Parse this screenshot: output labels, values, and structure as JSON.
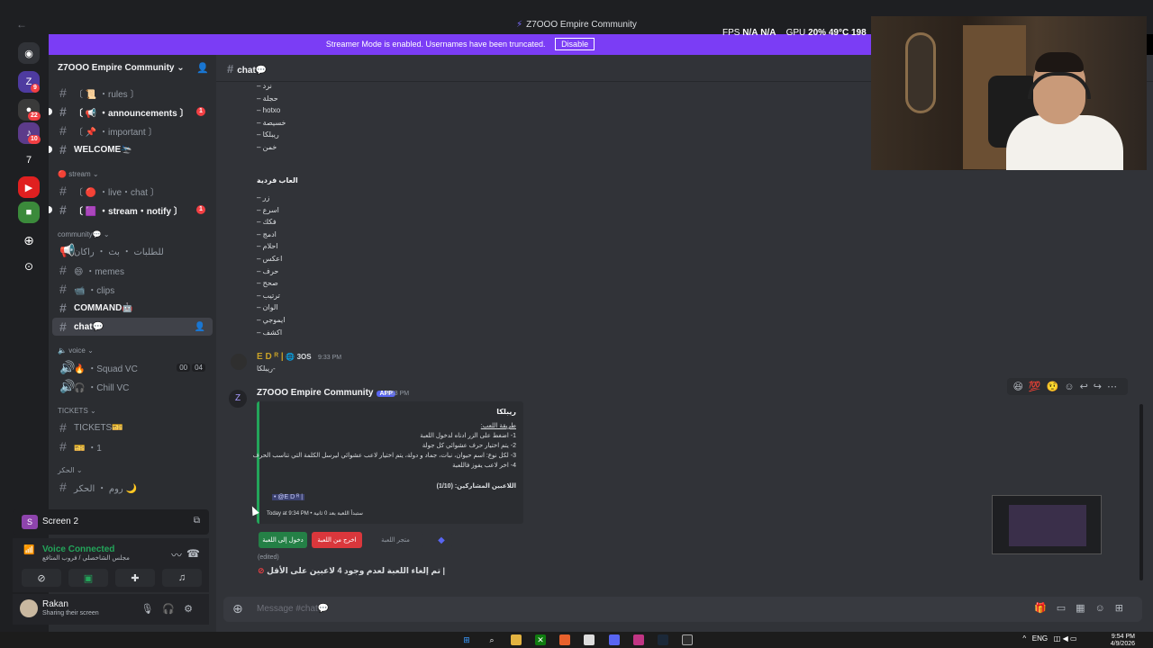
{
  "window": {
    "title": "Z7OOO Empire Community",
    "back_label": "←"
  },
  "overlay": {
    "fps_label": "FPS",
    "fps_value": "N/A",
    "fps_value2": "N/A",
    "gpu_label": "GPU",
    "gpu_pct": "20%",
    "gpu_temp": "49°C",
    "gpu_extra": "198"
  },
  "banner": {
    "text": "Streamer Mode is enabled. Usernames have been truncated.",
    "button": "Disable"
  },
  "rail": {
    "badges": [
      "9",
      "22",
      "10"
    ],
    "number_label": "7"
  },
  "server": {
    "name": "Z7OOO Empire Community"
  },
  "channels": {
    "rules": "〔 📜 ・rules 〕",
    "announcements": "〔 📢 ・announcements 〕",
    "important": "〔 📌 ・important 〕",
    "welcome": "WELCOME🛬",
    "cat_stream": "stream",
    "live_chat": "〔 🔴 ・live・chat 〕",
    "stream_notify": "〔 🟪 ・stream・notify 〕",
    "cat_community": "community💬",
    "rakan": "للطلبات ・ بث ・ راكان",
    "memes": "😄 ・memes",
    "clips": "📹 ・clips",
    "command": "COMMAND🤖",
    "chat": "chat💬",
    "cat_voice": "voice",
    "squad_vc": "🔥 ・Squad VC",
    "squad_count_a": "00",
    "squad_count_b": "04",
    "chill_vc": "🎧 ・Chill VC",
    "cat_tickets": "TICKETS",
    "tickets": "TICKETS🎫",
    "ticket_1": "🎫 ・1",
    "cat_rooms": "الحكر",
    "room": "روم ・ الحكر 🌙",
    "announcement_badge": "1",
    "notify_badge": "1"
  },
  "bottom": {
    "screen_label": "Screen 2",
    "screen_icon_letter": "S",
    "voice_status": "Voice Connected",
    "voice_sub": "مجلس الشاخصلي / فروب المتافع",
    "user_name": "Rakan",
    "user_status": "Sharing their screen"
  },
  "chat": {
    "channel": "chat💬",
    "list_top": [
      "نرد",
      "حجلة",
      "hotxo",
      "خسيصة",
      "ريبلكا",
      "خمن"
    ],
    "section_title": "العاب فردية",
    "list_solo": [
      "زر",
      "اسرع",
      "فكك",
      "ادمج",
      "احلام",
      "اعكس",
      "حرف",
      "صحح",
      "ترتيب",
      "الوان",
      "ايموجي",
      "اكشف"
    ],
    "msg1_author": "E D ᴿ |",
    "msg1_tag": "3OS",
    "msg1_time": "9:33 PM",
    "msg1_text": "-ريبلكا",
    "msg2_author": "Z7OOO Empire Community",
    "msg2_app": "APP",
    "msg2_time": "9:33 PM",
    "embed_title": "ريبلكا",
    "embed_lines": [
      "طريقة اللعب:",
      "1- اضغط على الزر ادناه لدخول اللعبة",
      "2- يتم اختيار حرف عشوائي كل جولة",
      "3- لكل نوع: اسم حيوان، نبات، جماد و دولة، يتم اختيار لاعب عشوائي ليرسل الكلمة التي تناسب الحرف",
      "4- اخر لاعب يفوز فاللعبة"
    ],
    "embed_players": "اللاعبين المشاركين: (1/10)",
    "embed_player": "@E D ᴿ |",
    "embed_footer": "Today at 9:34 PM • ستبدأ اللعبة بعد 0 ثانية",
    "btn_join": "دخول إلى اللعبة",
    "btn_leave": "اخرج من اللعبة",
    "btn_store": "متجر اللعبة",
    "edited": "(edited)",
    "cancel_msg": "تم إلغاء اللعبة لعدم وجود 4 لاعبين على الأقل |",
    "composer_placeholder": "Message #chat💬"
  },
  "taskbar": {
    "lang": "ENG",
    "time": "9:54 PM",
    "date": "4/9/2026"
  },
  "colors": {
    "accent": "#7b3df5",
    "blurple": "#5865f2",
    "green": "#23a55a",
    "red": "#f23f43"
  }
}
